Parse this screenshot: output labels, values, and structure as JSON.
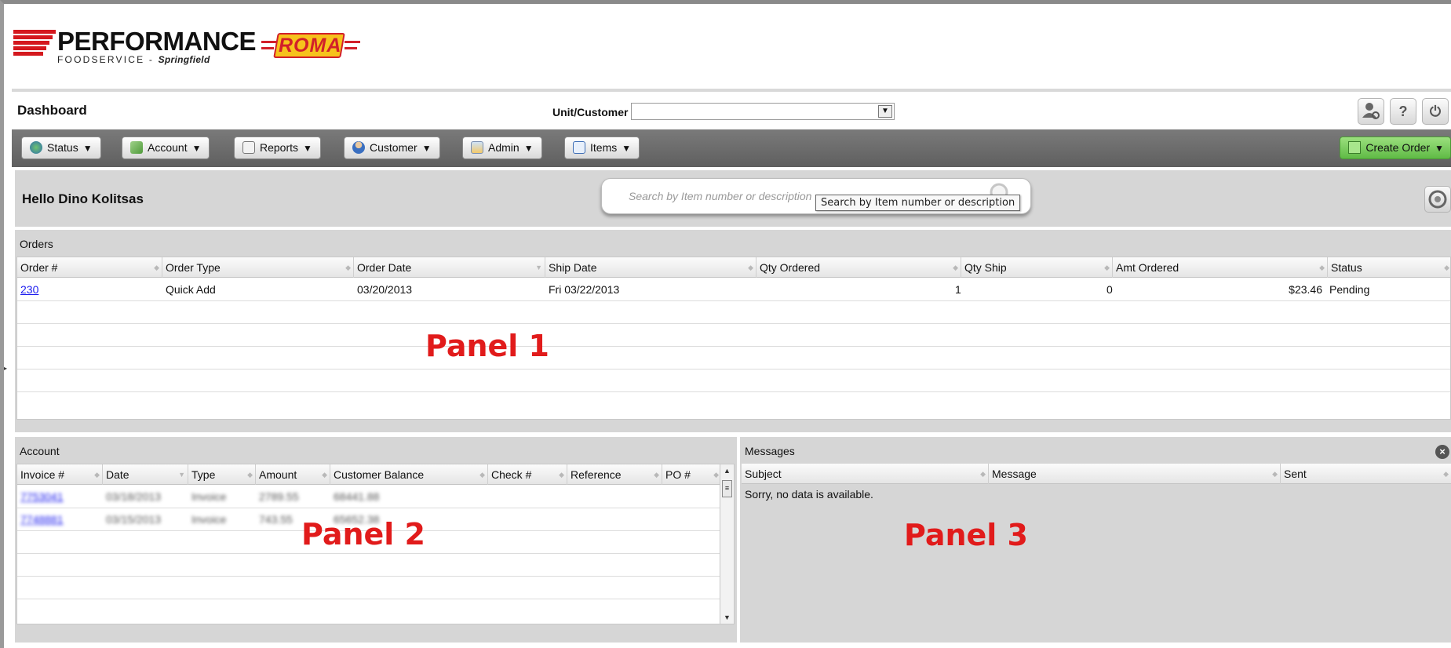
{
  "brand": {
    "name": "PERFORMANCE",
    "sub": "FOODSERVICE -",
    "sub_location": "Springfield",
    "partner": "ROMA"
  },
  "dashboard": {
    "title": "Dashboard",
    "unit_label": "Unit/Customer",
    "unit_value": "",
    "icons": [
      "user-settings-icon",
      "help-icon",
      "power-icon"
    ]
  },
  "toolbar": {
    "buttons": [
      {
        "label": "Status",
        "icon": "globe-icon"
      },
      {
        "label": "Account",
        "icon": "money-icon"
      },
      {
        "label": "Reports",
        "icon": "report-icon"
      },
      {
        "label": "Customer",
        "icon": "person-icon"
      },
      {
        "label": "Admin",
        "icon": "admin-icon"
      },
      {
        "label": "Items",
        "icon": "items-icon"
      }
    ],
    "caret": "▼",
    "create_order": "Create Order"
  },
  "hello": {
    "greeting": "Hello Dino Kolitsas",
    "search_placeholder": "Search by Item number or description",
    "search_tooltip": "Search by Item number or description"
  },
  "orders": {
    "title": "Orders",
    "columns": [
      "Order #",
      "Order Type",
      "Order Date",
      "Ship Date",
      "Qty Ordered",
      "Qty Ship",
      "Amt Ordered",
      "Status"
    ],
    "rows": [
      {
        "order_no": "230",
        "type": "Quick Add",
        "order_date": "03/20/2013",
        "ship_date": "Fri 03/22/2013",
        "qty_ordered": "1",
        "qty_ship": "0",
        "amt_ordered": "$23.46",
        "status": "Pending"
      }
    ],
    "overlay_label": "Panel 1"
  },
  "account": {
    "title": "Account",
    "columns": [
      "Invoice #",
      "Date",
      "Type",
      "Amount",
      "Customer Balance",
      "Check #",
      "Reference",
      "PO #"
    ],
    "rows": [
      {
        "invoice": "7753041",
        "date": "03/18/2013",
        "type": "Invoice",
        "amount": "2789.55",
        "balance": "68441.88"
      },
      {
        "invoice": "7748881",
        "date": "03/15/2013",
        "type": "Invoice",
        "amount": "743.55",
        "balance": "65652.38"
      }
    ],
    "overlay_label": "Panel 2"
  },
  "messages": {
    "title": "Messages",
    "columns": [
      "Subject",
      "Message",
      "Sent"
    ],
    "empty_text": "Sorry, no data is available.",
    "overlay_label": "Panel 3"
  }
}
